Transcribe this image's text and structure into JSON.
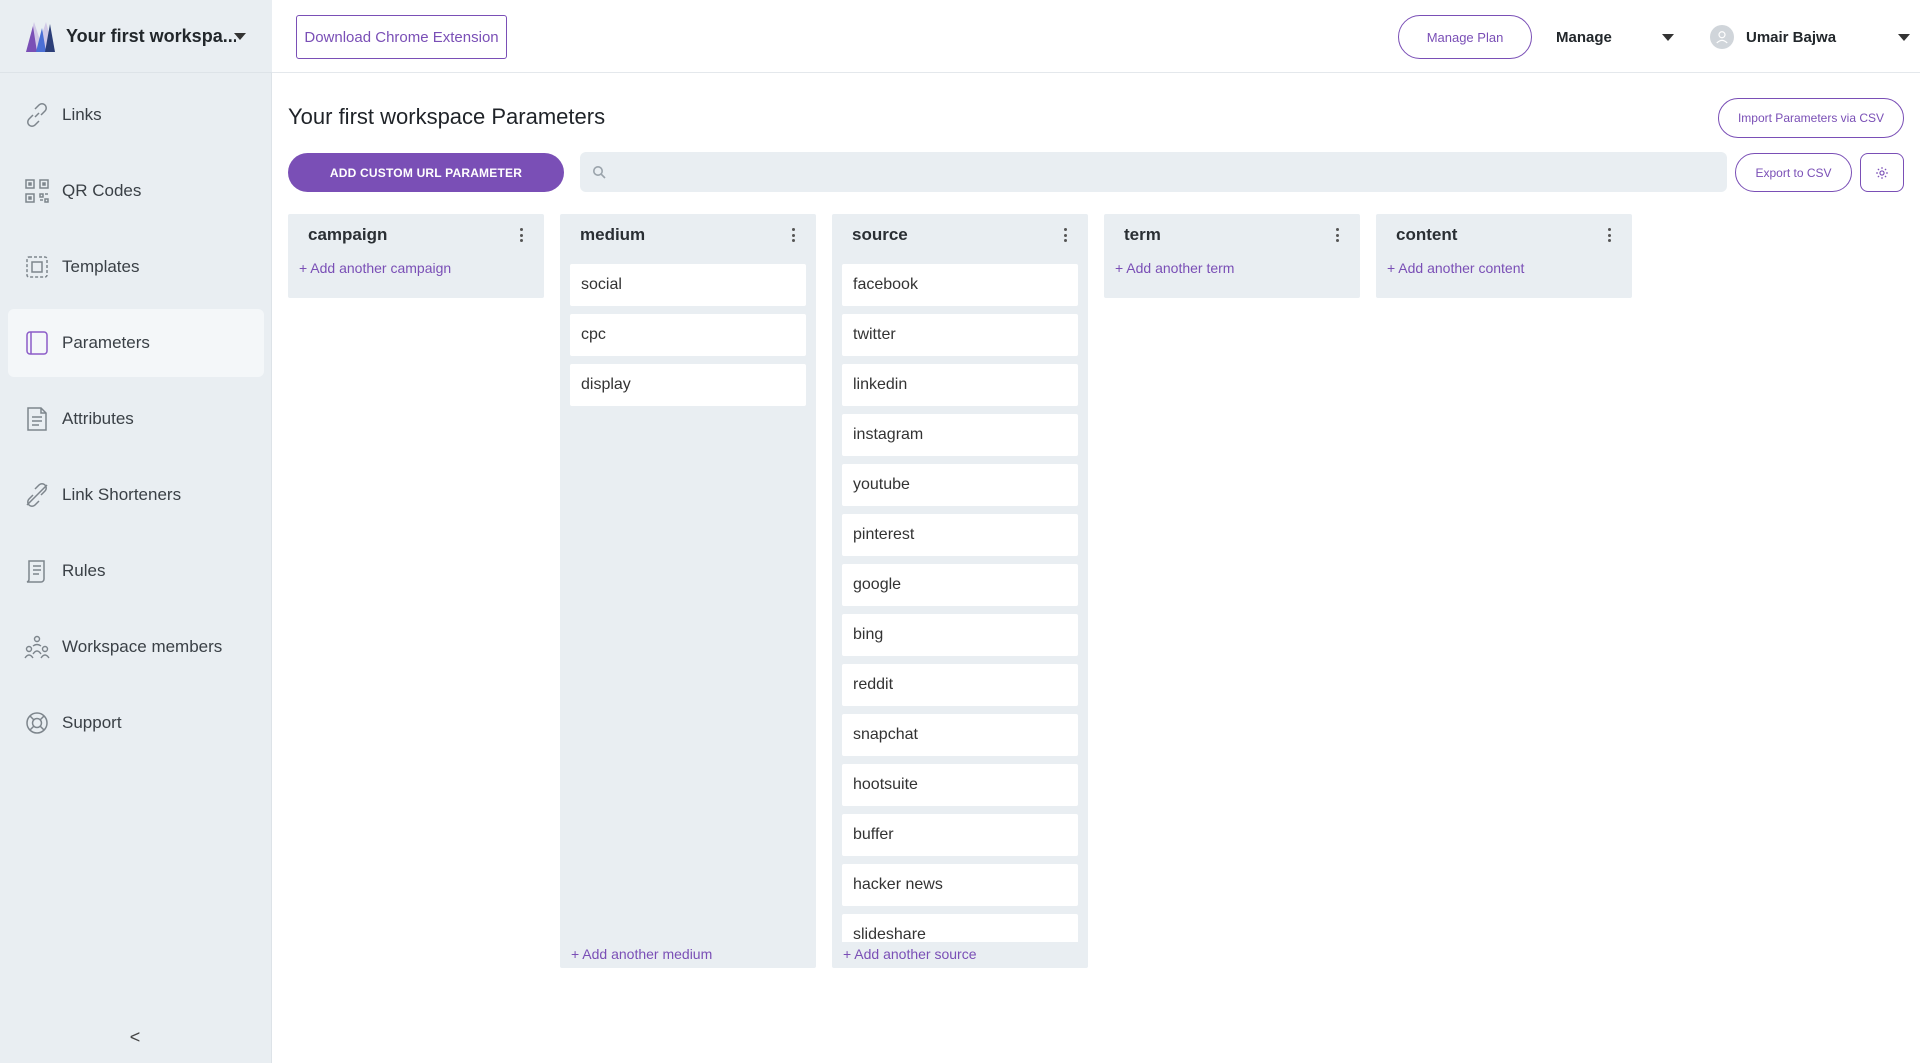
{
  "workspace": {
    "name": "Your first workspa..."
  },
  "sidebar": {
    "items": [
      {
        "label": "Links",
        "icon": "link-icon"
      },
      {
        "label": "QR Codes",
        "icon": "qr-code-icon"
      },
      {
        "label": "Templates",
        "icon": "templates-icon"
      },
      {
        "label": "Parameters",
        "icon": "parameters-icon",
        "active": true
      },
      {
        "label": "Attributes",
        "icon": "document-icon"
      },
      {
        "label": "Link Shorteners",
        "icon": "link-shortener-icon"
      },
      {
        "label": "Rules",
        "icon": "rules-icon"
      },
      {
        "label": "Workspace members",
        "icon": "members-icon"
      },
      {
        "label": "Support",
        "icon": "lifebuoy-icon"
      }
    ],
    "collapse_glyph": "<"
  },
  "topbar": {
    "chrome_extension_label": "Download Chrome Extension",
    "manage_plan_label": "Manage Plan",
    "manage_label": "Manage",
    "user_name": "Umair Bajwa"
  },
  "main": {
    "title": "Your first workspace Parameters",
    "import_label": "Import Parameters via CSV",
    "add_param_label": "ADD CUSTOM URL PARAMETER",
    "search_placeholder": "",
    "export_label": "Export to CSV"
  },
  "columns": [
    {
      "title": "campaign",
      "values": [],
      "add_label": "+ Add another campaign"
    },
    {
      "title": "medium",
      "values": [
        "social",
        "cpc",
        "display"
      ],
      "add_label": "+ Add another medium"
    },
    {
      "title": "source",
      "values": [
        "facebook",
        "twitter",
        "linkedin",
        "instagram",
        "youtube",
        "pinterest",
        "google",
        "bing",
        "reddit",
        "snapchat",
        "hootsuite",
        "buffer",
        "hacker news",
        "slideshare"
      ],
      "add_label": "+ Add another source"
    },
    {
      "title": "term",
      "values": [],
      "add_label": "+ Add another term"
    },
    {
      "title": "content",
      "values": [],
      "add_label": "+ Add another content"
    }
  ],
  "colors": {
    "accent": "#7a4fb6",
    "sidebar_bg": "#e9eef2",
    "column_bg": "#e9eef2"
  }
}
